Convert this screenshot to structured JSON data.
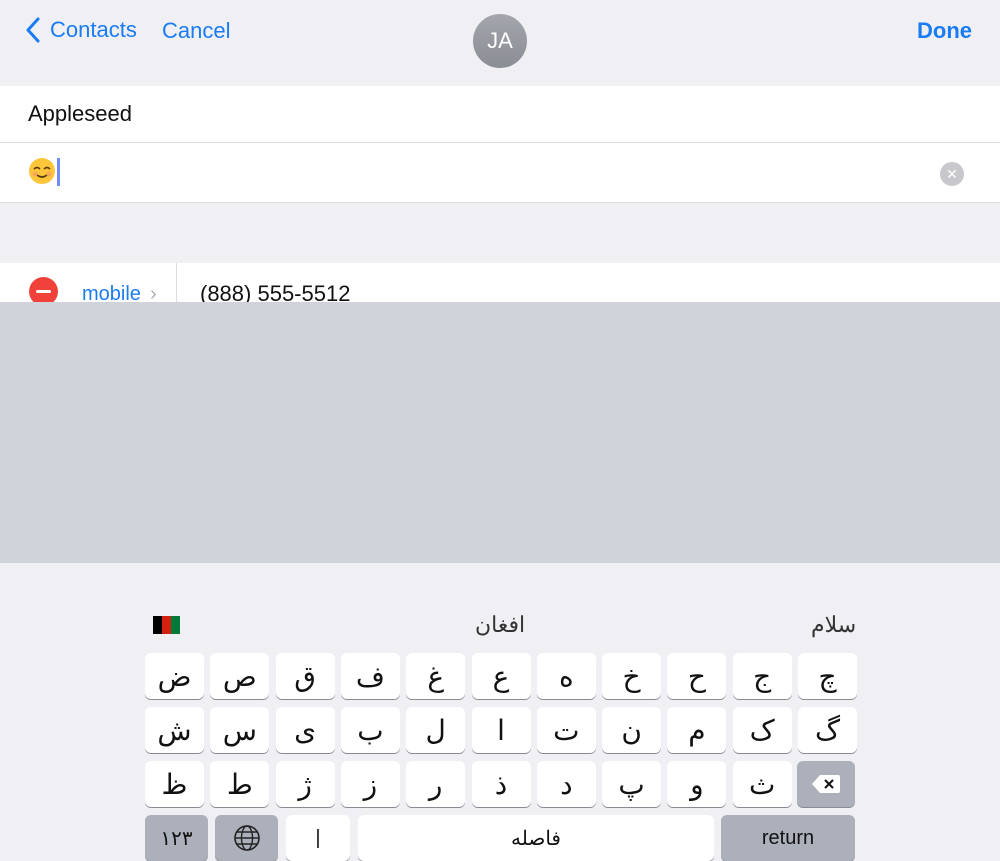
{
  "nav": {
    "back_label": "Contacts",
    "cancel_label": "Cancel",
    "avatar_initials": "JA",
    "done_label": "Done",
    "accent_color": "#1a7cf4"
  },
  "form": {
    "last_name": "Appleseed",
    "first_name_value": "😌",
    "phone": {
      "label": "mobile",
      "number": "(888) 555-5512"
    }
  },
  "keyboard": {
    "language_icon": "afghanistan-flag",
    "suggestions": [
      "افغان",
      "سلام"
    ],
    "row1": [
      "ض",
      "ص",
      "ق",
      "ف",
      "غ",
      "ع",
      "ه",
      "خ",
      "ح",
      "ج",
      "چ"
    ],
    "row2": [
      "ش",
      "س",
      "ی",
      "ب",
      "ل",
      "ا",
      "ت",
      "ن",
      "م",
      "ک",
      "گ"
    ],
    "row3": [
      "ظ",
      "ط",
      "ژ",
      "ز",
      "ر",
      "ذ",
      "د",
      "پ",
      "و",
      "ث"
    ],
    "numbers_key": "١٢٣",
    "zwnj_key": "|",
    "space_key": "فاصله",
    "return_key": "return"
  }
}
